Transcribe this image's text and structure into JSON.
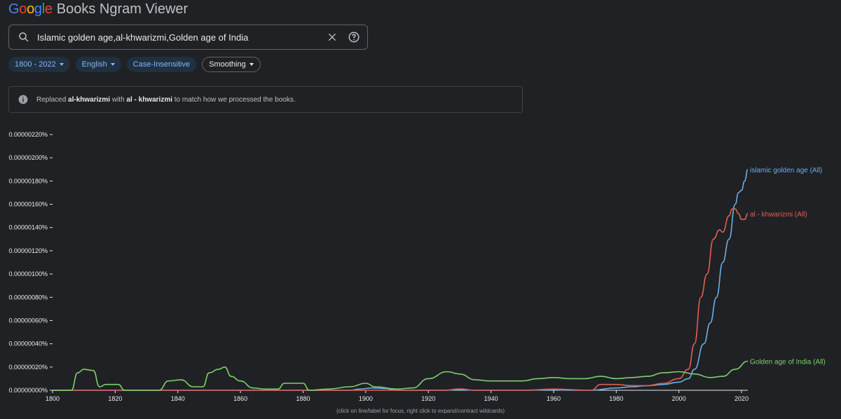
{
  "header": {
    "logo": {
      "letters": [
        "G",
        "o",
        "o",
        "g",
        "l",
        "e"
      ],
      "colors": [
        "#4285f4",
        "#ea4335",
        "#fbbc05",
        "#4285f4",
        "#34a853",
        "#ea4335"
      ],
      "rest": "Books Ngram Viewer"
    }
  },
  "search": {
    "value": "Islamic golden age,al-khwarizmi,Golden age of India",
    "icon": "search-icon"
  },
  "filters": [
    {
      "label": "1800 - 2022",
      "style": "filled",
      "caret": true
    },
    {
      "label": "English",
      "style": "filled",
      "caret": true
    },
    {
      "label": "Case-Insensitive",
      "style": "filled",
      "caret": false
    },
    {
      "label": "Smoothing",
      "style": "outline",
      "caret": true
    }
  ],
  "notice": {
    "prefix": "Replaced ",
    "original": "al-khwarizmi",
    "middle": " with ",
    "replacement": "al - khwarizmi",
    "suffix": " to match how we processed the books."
  },
  "chart_data": {
    "type": "line",
    "xlim": [
      1800,
      2022
    ],
    "ylim": [
      0,
      2.2e-06
    ],
    "x_ticks": [
      1800,
      1820,
      1840,
      1860,
      1880,
      1900,
      1920,
      1940,
      1960,
      1980,
      2000,
      2020
    ],
    "y_ticks": [
      "0.00000000%",
      "0.00000020%",
      "0.00000040%",
      "0.00000060%",
      "0.00000080%",
      "0.00000100%",
      "0.00000120%",
      "0.00000140%",
      "0.00000160%",
      "0.00000180%",
      "0.00000200%",
      "0.00000220%"
    ],
    "series": [
      {
        "name": "islamic golden age (All)",
        "color": "#6aaee8",
        "points": [
          [
            1800,
            0
          ],
          [
            1895,
            0
          ],
          [
            1898,
            1e-08
          ],
          [
            1902,
            2e-08
          ],
          [
            1906,
            1.5e-08
          ],
          [
            1910,
            0
          ],
          [
            1925,
            0
          ],
          [
            1930,
            5e-09
          ],
          [
            1935,
            0
          ],
          [
            1950,
            0
          ],
          [
            1960,
            5e-09
          ],
          [
            1965,
            0
          ],
          [
            1972,
            0
          ],
          [
            1980,
            2e-08
          ],
          [
            1985,
            3e-08
          ],
          [
            1990,
            4e-08
          ],
          [
            1995,
            5e-08
          ],
          [
            2000,
            7e-08
          ],
          [
            2003,
            1e-07
          ],
          [
            2005,
            1.8e-07
          ],
          [
            2008,
            4e-07
          ],
          [
            2010,
            5.8e-07
          ],
          [
            2012,
            8e-07
          ],
          [
            2014,
            1.1e-06
          ],
          [
            2016,
            1.3e-06
          ],
          [
            2018,
            1.6e-06
          ],
          [
            2019,
            1.7e-06
          ],
          [
            2020,
            1.72e-06
          ],
          [
            2021,
            1.8e-06
          ],
          [
            2022,
            1.9e-06
          ]
        ]
      },
      {
        "name": "al - khwarizmi (All)",
        "color": "#e05e52",
        "points": [
          [
            1800,
            0
          ],
          [
            1925,
            0
          ],
          [
            1930,
            1.2e-08
          ],
          [
            1935,
            0
          ],
          [
            1950,
            0
          ],
          [
            1960,
            1e-08
          ],
          [
            1972,
            0
          ],
          [
            1975,
            5e-08
          ],
          [
            1980,
            5e-08
          ],
          [
            1985,
            4e-08
          ],
          [
            1990,
            4e-08
          ],
          [
            1995,
            6e-08
          ],
          [
            2000,
            1e-07
          ],
          [
            2003,
            1.8e-07
          ],
          [
            2005,
            4e-07
          ],
          [
            2007,
            8e-07
          ],
          [
            2009,
            1e-06
          ],
          [
            2011,
            1.3e-06
          ],
          [
            2013,
            1.38e-06
          ],
          [
            2014,
            1.36e-06
          ],
          [
            2016,
            1.5e-06
          ],
          [
            2017,
            1.56e-06
          ],
          [
            2018,
            1.56e-06
          ],
          [
            2019,
            1.52e-06
          ],
          [
            2020,
            1.47e-06
          ],
          [
            2021,
            1.47e-06
          ],
          [
            2022,
            1.52e-06
          ]
        ]
      },
      {
        "name": "Golden age of India (All)",
        "color": "#7ccf6e",
        "points": [
          [
            1800,
            0
          ],
          [
            1806,
            0
          ],
          [
            1808,
            1.5e-07
          ],
          [
            1810,
            1.8e-07
          ],
          [
            1813,
            1.7e-07
          ],
          [
            1815,
            3e-08
          ],
          [
            1817,
            5e-08
          ],
          [
            1821,
            5e-08
          ],
          [
            1823,
            0
          ],
          [
            1834,
            0
          ],
          [
            1837,
            8e-08
          ],
          [
            1841,
            9e-08
          ],
          [
            1845,
            3e-08
          ],
          [
            1848,
            3e-08
          ],
          [
            1850,
            1.5e-07
          ],
          [
            1853,
            1.8e-07
          ],
          [
            1855,
            2e-07
          ],
          [
            1857,
            1.2e-07
          ],
          [
            1860,
            8e-08
          ],
          [
            1864,
            2e-08
          ],
          [
            1868,
            1e-08
          ],
          [
            1872,
            1e-08
          ],
          [
            1874,
            6e-08
          ],
          [
            1880,
            6e-08
          ],
          [
            1882,
            0
          ],
          [
            1888,
            1e-08
          ],
          [
            1895,
            3e-08
          ],
          [
            1900,
            6e-08
          ],
          [
            1903,
            3e-08
          ],
          [
            1910,
            1e-08
          ],
          [
            1915,
            2e-08
          ],
          [
            1920,
            1e-07
          ],
          [
            1926,
            1.6e-07
          ],
          [
            1930,
            1.4e-07
          ],
          [
            1935,
            9e-08
          ],
          [
            1940,
            8e-08
          ],
          [
            1945,
            8e-08
          ],
          [
            1950,
            8e-08
          ],
          [
            1955,
            1e-07
          ],
          [
            1960,
            1.1e-07
          ],
          [
            1965,
            1e-07
          ],
          [
            1970,
            1e-07
          ],
          [
            1975,
            1.2e-07
          ],
          [
            1980,
            1e-07
          ],
          [
            1985,
            1.1e-07
          ],
          [
            1990,
            1.2e-07
          ],
          [
            1995,
            1.5e-07
          ],
          [
            2000,
            1.6e-07
          ],
          [
            2005,
            1.4e-07
          ],
          [
            2010,
            1.1e-07
          ],
          [
            2014,
            1.2e-07
          ],
          [
            2018,
            1.8e-07
          ],
          [
            2022,
            2.5e-07
          ]
        ]
      }
    ]
  },
  "footnote": "(click on line/label for focus, right click to expand/contract wildcards)"
}
